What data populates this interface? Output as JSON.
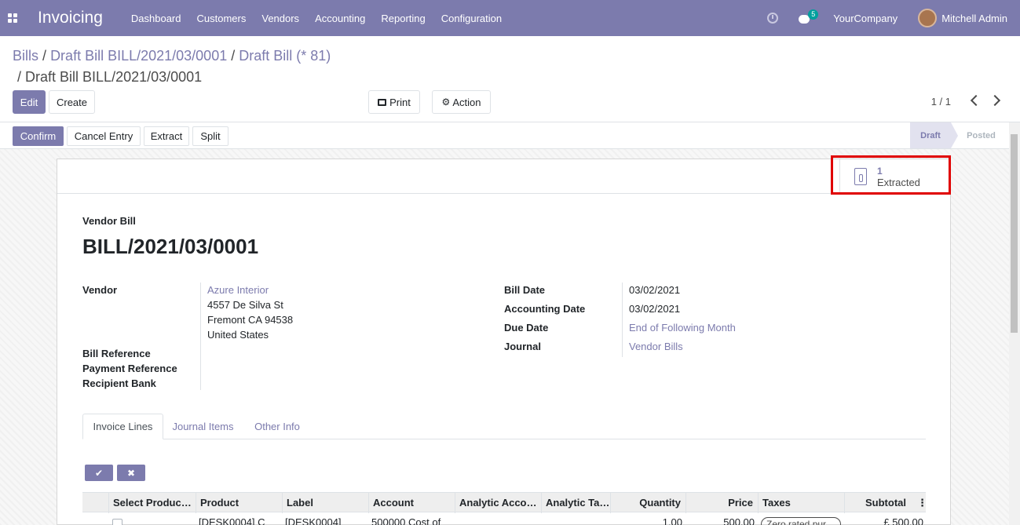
{
  "navbar": {
    "app_name": "Invoicing",
    "menu": [
      "Dashboard",
      "Customers",
      "Vendors",
      "Accounting",
      "Reporting",
      "Configuration"
    ],
    "chat_count": "5",
    "company": "YourCompany",
    "user": "Mitchell Admin"
  },
  "breadcrumb": {
    "items": [
      "Bills",
      "Draft Bill BILL/2021/03/0001",
      "Draft Bill (* 81)"
    ],
    "current": "Draft Bill BILL/2021/03/0001",
    "separator": "/"
  },
  "control_panel": {
    "edit": "Edit",
    "create": "Create",
    "print": "Print",
    "action": "Action",
    "pager": "1 / 1"
  },
  "statusbar": {
    "buttons": [
      "Confirm",
      "Cancel Entry",
      "Extract",
      "Split"
    ],
    "stages": [
      {
        "label": "Draft",
        "active": true
      },
      {
        "label": "Posted",
        "active": false
      }
    ]
  },
  "smart_button": {
    "count": "1",
    "label": "Extracted"
  },
  "form": {
    "type_label": "Vendor Bill",
    "name": "BILL/2021/03/0001",
    "left_fields": {
      "vendor_label": "Vendor",
      "vendor_name": "Azure Interior",
      "vendor_address": [
        "4557 De Silva St",
        "Fremont CA 94538",
        "United States"
      ],
      "bill_reference_label": "Bill Reference",
      "payment_reference_label": "Payment Reference",
      "recipient_bank_label": "Recipient Bank"
    },
    "right_fields": [
      {
        "label": "Bill Date",
        "value": "03/02/2021",
        "link": false
      },
      {
        "label": "Accounting Date",
        "value": "03/02/2021",
        "link": false
      },
      {
        "label": "Due Date",
        "value": "End of Following Month",
        "link": true
      },
      {
        "label": "Journal",
        "value": "Vendor Bills",
        "link": true
      }
    ]
  },
  "tabs": [
    "Invoice Lines",
    "Journal Items",
    "Other Info"
  ],
  "lines": {
    "columns": [
      "Select Produc…",
      "Product",
      "Label",
      "Account",
      "Analytic Acco…",
      "Analytic Tags",
      "Quantity",
      "Price",
      "Taxes",
      "Subtotal"
    ],
    "row": {
      "product": "[DESK0004] C",
      "label": "[DESK0004]",
      "account": "500000 Cost of",
      "quantity": "1.00",
      "price": "500.00",
      "taxes": "Zero rated pur",
      "subtotal": "£ 500.00"
    }
  }
}
